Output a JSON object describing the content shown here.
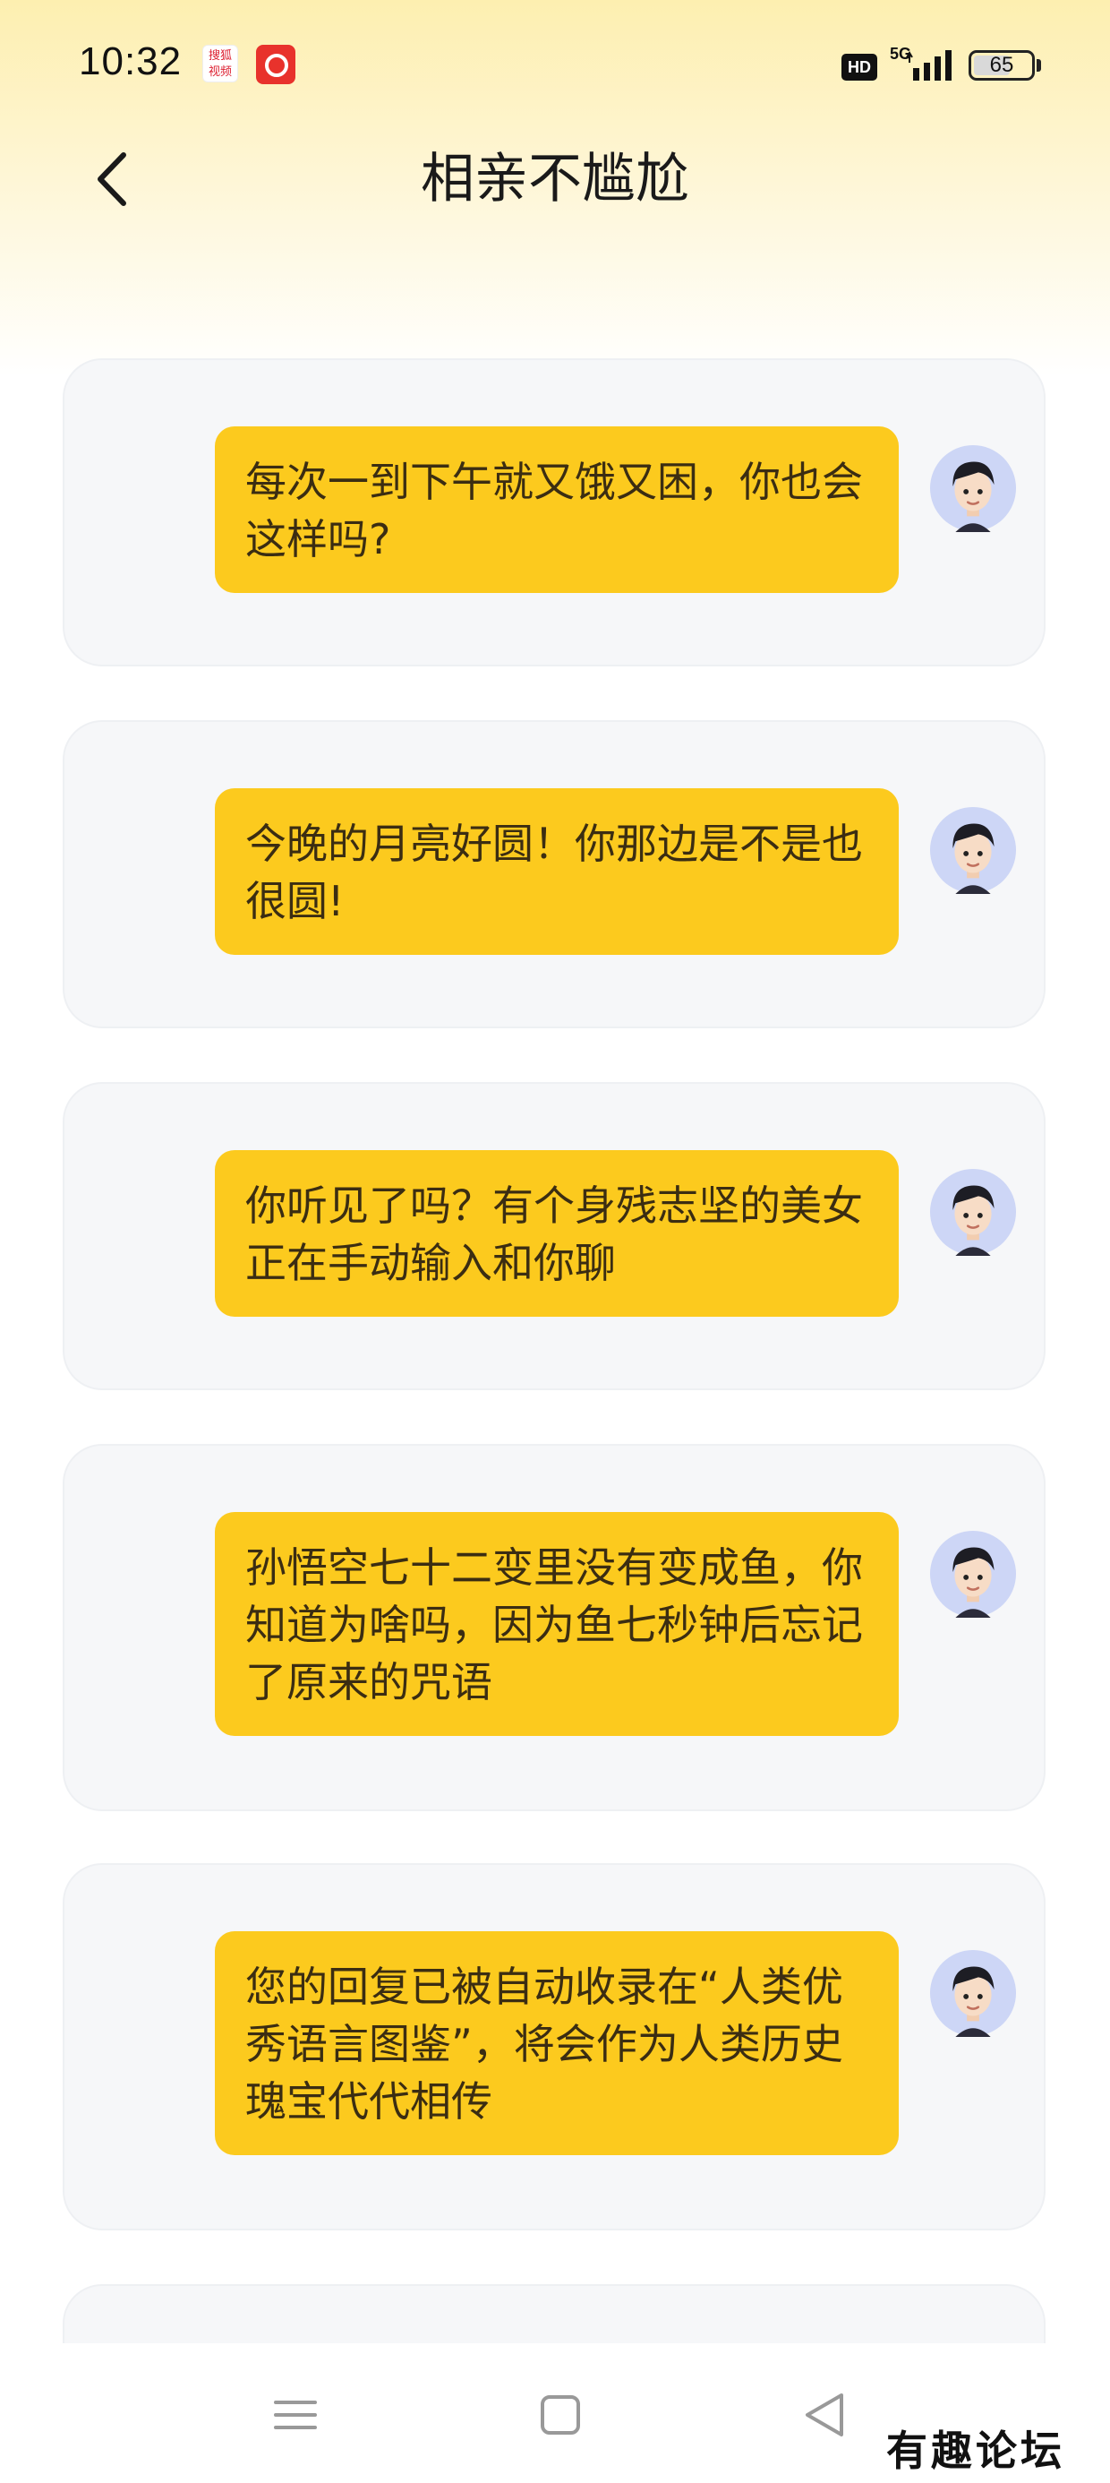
{
  "status_bar": {
    "time": "10:32",
    "sohu_badge": "搜狐\n视频",
    "hd_label": "HD",
    "network_label": "5G",
    "battery_level": 65,
    "battery_text": "65"
  },
  "header": {
    "title": "相亲不尴尬",
    "back_icon": "chevron-left-icon"
  },
  "messages": [
    {
      "text": "每次一到下午就又饿又困，你也会这样吗?"
    },
    {
      "text": "今晚的月亮好圆！你那边是不是也很圆!"
    },
    {
      "text": "你听见了吗？有个身残志坚的美女正在手动输入和你聊"
    },
    {
      "text": "孙悟空七十二变里没有变成鱼，你知道为啥吗，因为鱼七秒钟后忘记了原来的咒语"
    },
    {
      "text": "您的回复已被自动收录在“人类优秀语言图鉴”，将会作为人类历史瑰宝代代相传"
    }
  ],
  "colors": {
    "bubble": "#fcca1e",
    "bubble_text": "#3b2d12",
    "card_bg": "#f6f7f9",
    "header_gradient_top": "#fdefb0"
  },
  "nav": {
    "menu_icon": "menu-icon",
    "home_icon": "square-home-icon",
    "back_icon": "triangle-back-icon"
  },
  "watermark": "有趣论坛"
}
